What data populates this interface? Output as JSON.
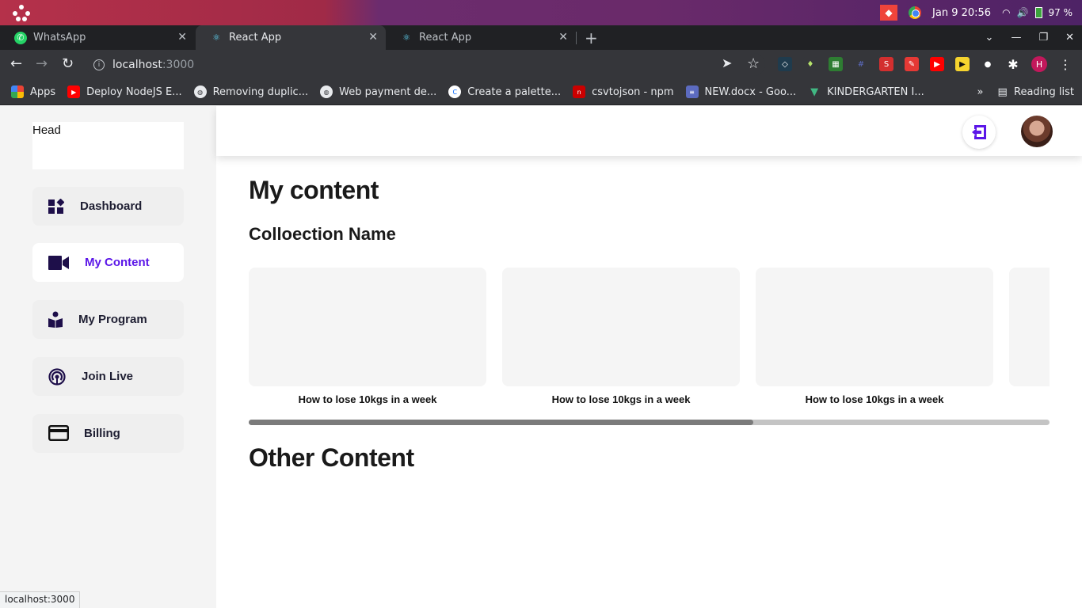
{
  "os": {
    "clock": "Jan 9  20:56",
    "battery": "97 %"
  },
  "tabs": [
    {
      "title": "WhatsApp",
      "active": false
    },
    {
      "title": "React App",
      "active": true
    },
    {
      "title": "React App",
      "active": false
    }
  ],
  "address": {
    "host": "localhost",
    "port": ":3000"
  },
  "bookmarks": [
    {
      "label": "Apps",
      "icon": "apps-grid-icon"
    },
    {
      "label": "Deploy NodeJS E...",
      "icon": "youtube-icon"
    },
    {
      "label": "Removing duplic...",
      "icon": "globe-icon"
    },
    {
      "label": "Web payment de...",
      "icon": "globe-icon"
    },
    {
      "label": "Create a palette...",
      "icon": "coolors-icon"
    },
    {
      "label": "csvtojson - npm",
      "icon": "npm-icon"
    },
    {
      "label": "NEW.docx - Goo...",
      "icon": "docs-icon"
    },
    {
      "label": "KINDERGARTEN I...",
      "icon": "vue-icon"
    }
  ],
  "reading_list": "Reading list",
  "profile_initial": "H",
  "sidebar": {
    "head": "Head",
    "items": [
      {
        "label": "Dashboard",
        "icon": "dashboard-icon",
        "active": false
      },
      {
        "label": "My Content",
        "icon": "video-camera-icon",
        "active": true
      },
      {
        "label": "My Program",
        "icon": "reading-person-icon",
        "active": false
      },
      {
        "label": "Join Live",
        "icon": "broadcast-icon",
        "active": false
      },
      {
        "label": "Billing",
        "icon": "credit-card-icon",
        "active": false
      }
    ]
  },
  "main": {
    "title": "My content",
    "collection_title": "Colloection Name",
    "cards": [
      {
        "caption": "How to lose 10kgs in a week"
      },
      {
        "caption": "How to lose 10kgs in a week"
      },
      {
        "caption": "How to lose 10kgs in a week"
      },
      {
        "caption": ""
      }
    ],
    "scroll_progress": 0.63,
    "other_title": "Other Content"
  },
  "status_url": "localhost:3000",
  "colors": {
    "accent": "#5b16e8",
    "sidebar_bg": "#f4f4f4",
    "icon_dark": "#1e0f4a"
  }
}
